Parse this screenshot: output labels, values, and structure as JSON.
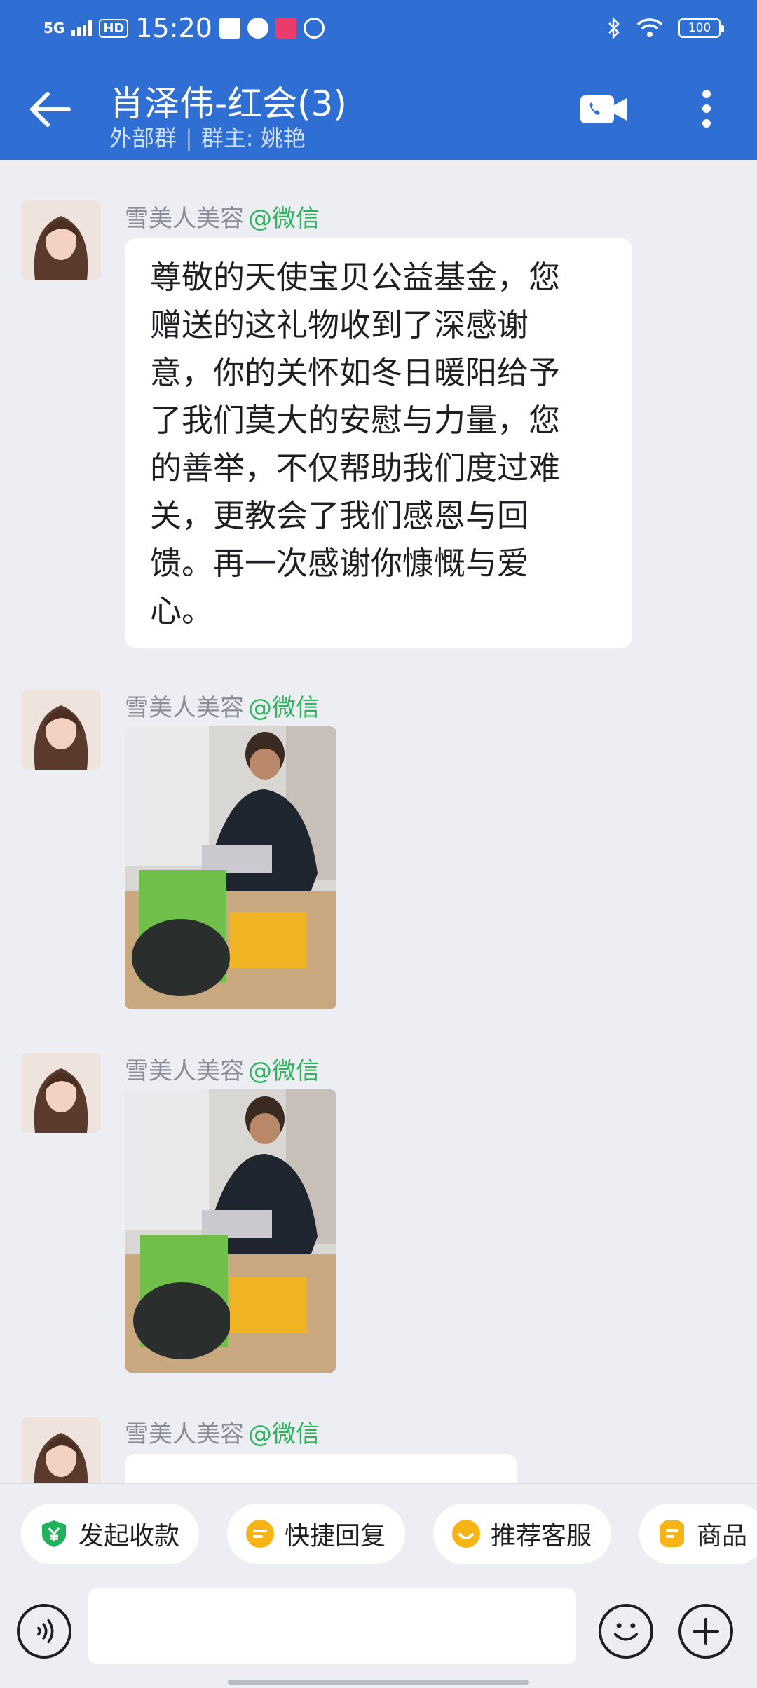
{
  "colors": {
    "header_bg": "#2f6fd4",
    "chat_bg": "#eceef3",
    "tag_green": "#2cb55b"
  },
  "status_bar": {
    "network": "5G",
    "hd": "HD",
    "time": "15:20",
    "battery": "100",
    "icons": [
      "signal-icon",
      "sim-icon",
      "play-icon",
      "app-icon",
      "link-icon",
      "bluetooth-icon",
      "wifi-icon",
      "battery-icon"
    ]
  },
  "header": {
    "title": "肖泽伟-红会(3)",
    "subtitle_type": "外部群",
    "subtitle_owner": "群主: 姚艳",
    "icons": [
      "back-arrow-icon",
      "video-call-icon",
      "more-vertical-icon"
    ]
  },
  "messages": [
    {
      "sender": "雪美人美容",
      "tag": "@微信",
      "type": "text",
      "lines": [
        "尊敬的天使宝贝公益基金，您",
        "赠送的这礼物收到了深感谢",
        "意，你的关怀如冬日暖阳给予",
        "了我们莫大的安慰与力量，您",
        "的善举，不仅帮助我们度过难",
        "关，更教会了我们感恩与回",
        "馈。再一次感谢你慷慨与爱",
        "心。"
      ]
    },
    {
      "sender": "雪美人美容",
      "tag": "@微信",
      "type": "image"
    },
    {
      "sender": "雪美人美容",
      "tag": "@微信",
      "type": "image"
    },
    {
      "sender": "雪美人美容",
      "tag": "@微信",
      "type": "text-partial"
    }
  ],
  "quick_actions": [
    {
      "label": "发起收款",
      "icon": "payment-shield-icon",
      "color": "#1fb25a"
    },
    {
      "label": "快捷回复",
      "icon": "quick-reply-icon",
      "color": "#f6b417"
    },
    {
      "label": "推荐客服",
      "icon": "recommend-service-icon",
      "color": "#f6b417"
    },
    {
      "label": "商品",
      "icon": "product-icon",
      "color": "#f6b417"
    }
  ],
  "composer": {
    "input_value": "",
    "icons": [
      "voice-icon",
      "emoji-icon",
      "plus-icon"
    ]
  }
}
